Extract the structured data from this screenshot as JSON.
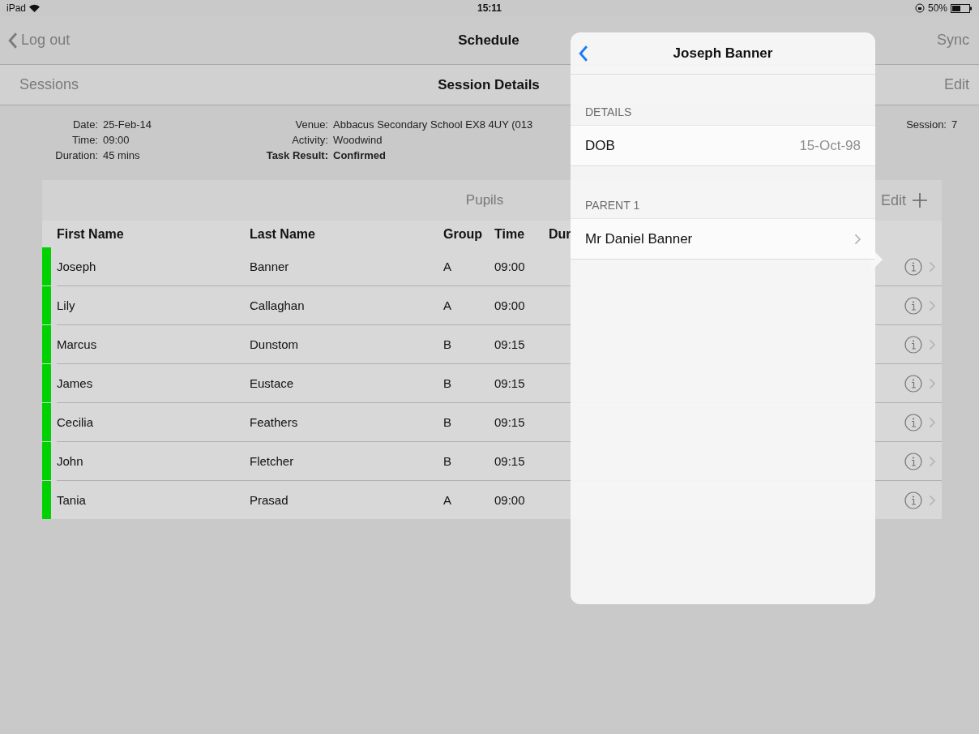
{
  "status_bar": {
    "device": "iPad",
    "time": "15:11",
    "battery": "50%"
  },
  "nav": {
    "back": "Log out",
    "title": "Schedule",
    "action": "Sync"
  },
  "sub_nav": {
    "back": "Sessions",
    "title": "Session Details",
    "action": "Edit"
  },
  "session": {
    "left": [
      {
        "label": "Date:",
        "value": "25-Feb-14",
        "bold": false
      },
      {
        "label": "Time:",
        "value": "09:00",
        "bold": false
      },
      {
        "label": "Duration:",
        "value": "45 mins",
        "bold": false
      }
    ],
    "middle": [
      {
        "label": "Venue:",
        "value": "Abbacus Secondary School EX8 4UY (013",
        "bold": false
      },
      {
        "label": "Activity:",
        "value": "Woodwind",
        "bold": false
      },
      {
        "label": "Task Result:",
        "value": "Confirmed",
        "bold": true
      }
    ],
    "right": {
      "label": "Session:",
      "value": "7"
    }
  },
  "pupils": {
    "title": "Pupils",
    "edit": "Edit",
    "columns": [
      "First Name",
      "Last Name",
      "Group",
      "Time",
      "Dur"
    ],
    "rows": [
      {
        "first": "Joseph",
        "last": "Banner",
        "group": "A",
        "time": "09:00",
        "color": "#00d100"
      },
      {
        "first": "Lily",
        "last": "Callaghan",
        "group": "A",
        "time": "09:00",
        "color": "#00d100"
      },
      {
        "first": "Marcus",
        "last": "Dunstom",
        "group": "B",
        "time": "09:15",
        "color": "#00d100"
      },
      {
        "first": "James",
        "last": "Eustace",
        "group": "B",
        "time": "09:15",
        "color": "#00d100"
      },
      {
        "first": "Cecilia",
        "last": "Feathers",
        "group": "B",
        "time": "09:15",
        "color": "#00d100"
      },
      {
        "first": "John",
        "last": "Fletcher",
        "group": "B",
        "time": "09:15",
        "color": "#00d100"
      },
      {
        "first": "Tania",
        "last": "Prasad",
        "group": "A",
        "time": "09:00",
        "color": "#00d100"
      }
    ]
  },
  "popover": {
    "title": "Joseph Banner",
    "sections": [
      {
        "header": "DETAILS",
        "rows": [
          {
            "label": "DOB",
            "value": "15-Oct-98",
            "disclosure": false
          }
        ]
      },
      {
        "header": "PARENT 1",
        "rows": [
          {
            "label": "Mr Daniel Banner",
            "disclosure": true
          }
        ]
      }
    ]
  }
}
